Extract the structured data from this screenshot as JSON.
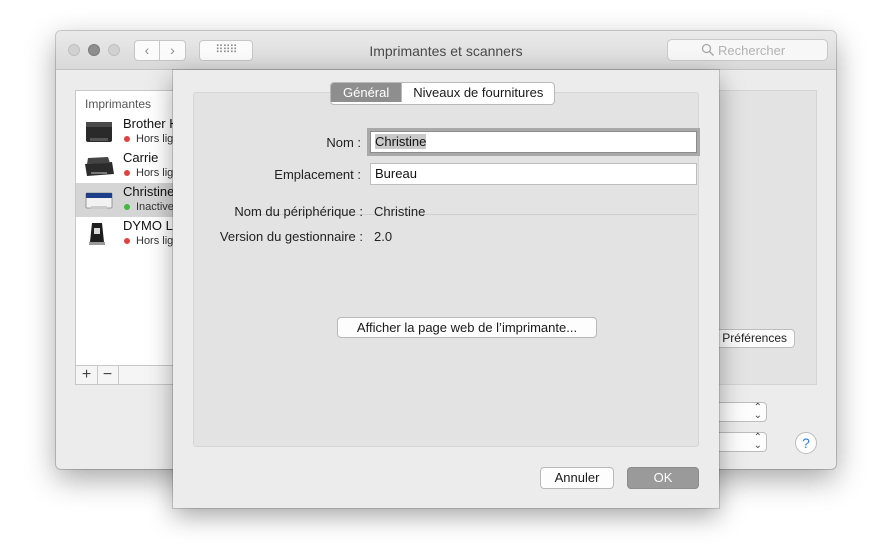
{
  "window": {
    "title": "Imprimantes et scanners",
    "search_placeholder": "Rechercher"
  },
  "printers": {
    "header": "Imprimantes",
    "items": [
      {
        "name": "Brother HL",
        "status": "Hors ligne",
        "status_color": "#e0433e",
        "selected": false
      },
      {
        "name": "Carrie",
        "status": "Hors ligne",
        "status_color": "#e0433e",
        "selected": false
      },
      {
        "name": "Christine",
        "status": "Inactive",
        "status_color": "#3fb93f",
        "selected": true
      },
      {
        "name": "DYMO LabelWriter",
        "status": "Hors ligne",
        "status_color": "#e0433e",
        "selected": false
      }
    ],
    "add_label": "+",
    "remove_label": "−"
  },
  "background": {
    "share_button": "Préférences Partage...",
    "help_label": "?"
  },
  "sheet": {
    "tabs": [
      {
        "label": "Général",
        "active": true
      },
      {
        "label": "Niveaux de fournitures",
        "active": false
      }
    ],
    "name_label": "Nom :",
    "name_value": "Christine",
    "location_label": "Emplacement :",
    "location_value": "Bureau",
    "device_name_label": "Nom du périphérique :",
    "device_name_value": "Christine",
    "driver_version_label": "Version du gestionnaire :",
    "driver_version_value": "2.0",
    "webpage_button": "Afficher la page web de l’imprimante...",
    "cancel_button": "Annuler",
    "ok_button": "OK"
  }
}
